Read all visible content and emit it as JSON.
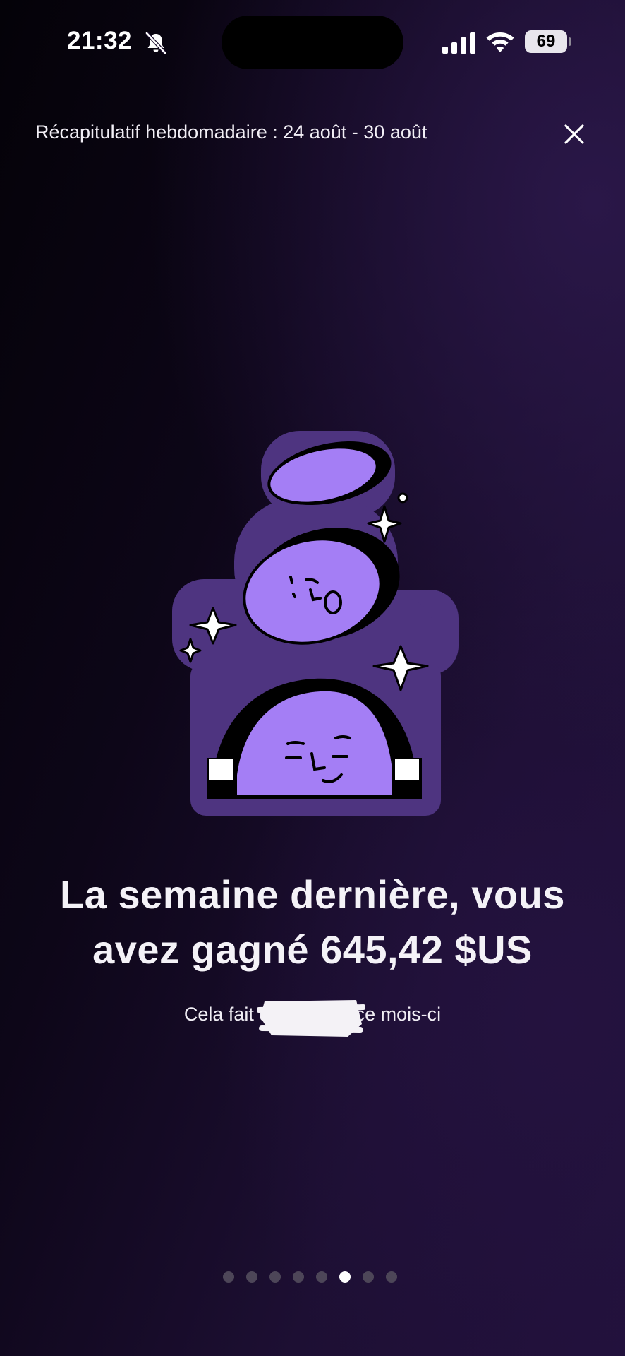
{
  "status_bar": {
    "time": "21:32",
    "battery": "69"
  },
  "header": {
    "title": "Récapitulatif hebdomadaire : 24 août - 30 août"
  },
  "main": {
    "headline_line1": "La semaine dernière, vous",
    "headline_line2": "avez gagné 645,42 $US",
    "subtext": "Cela fait d█████S ce mois-ci"
  },
  "pagination": {
    "total": 8,
    "active_index": 5
  },
  "colors": {
    "accent": "#a47ef5",
    "sticker_bg": "#4e3480",
    "background": "#1d0f33"
  },
  "icons": [
    "bell-slash-icon",
    "signal-icon",
    "wifi-icon",
    "battery-icon",
    "close-icon"
  ]
}
